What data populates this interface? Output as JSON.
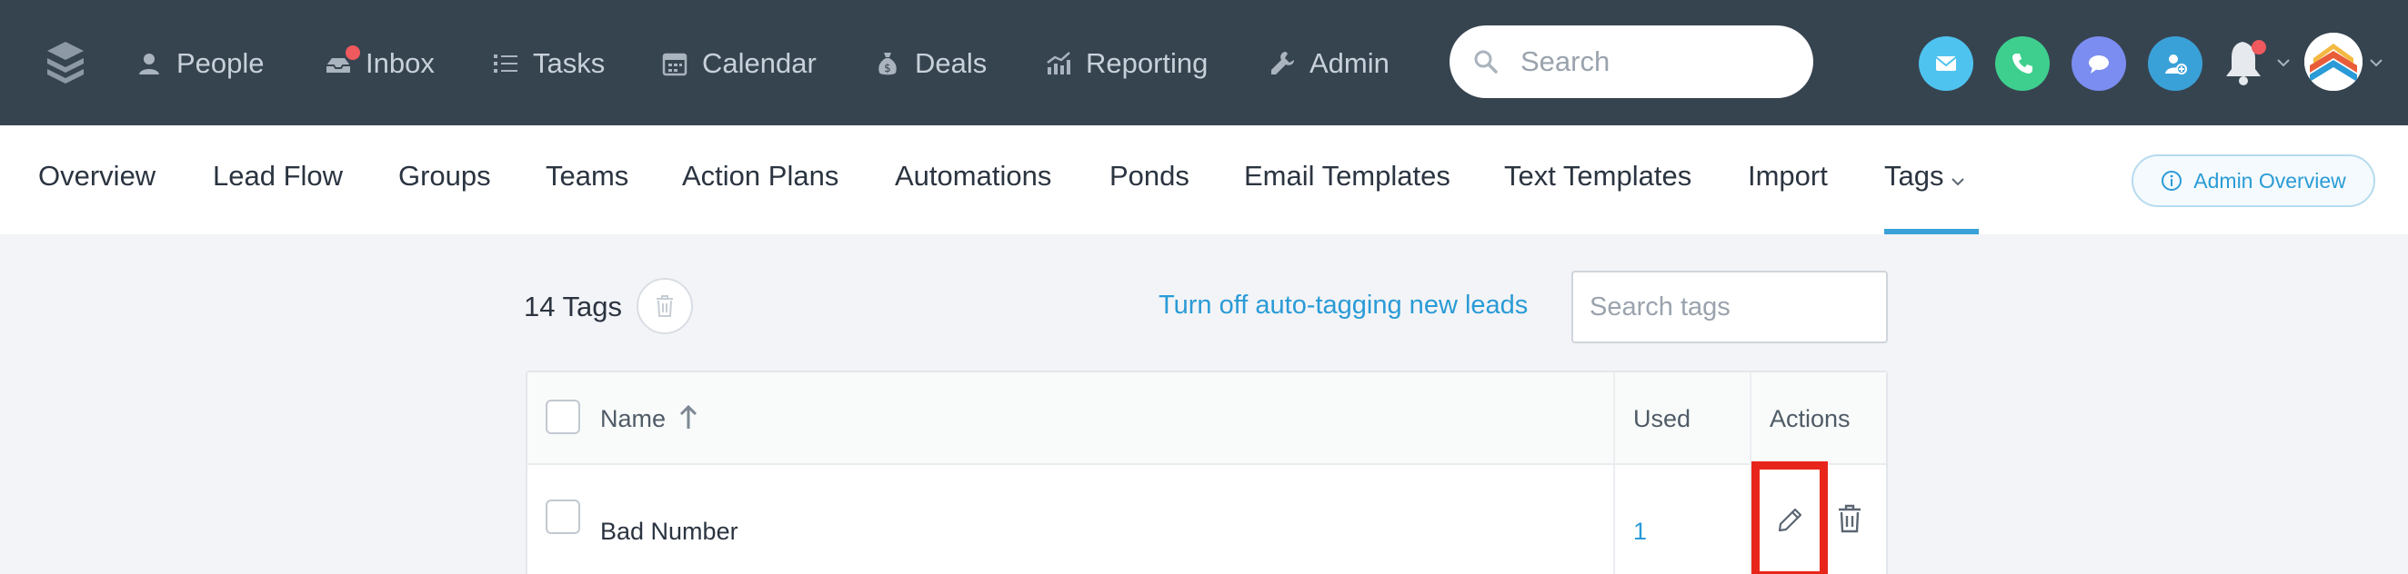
{
  "nav": {
    "items": [
      {
        "label": "People",
        "icon": "person-icon"
      },
      {
        "label": "Inbox",
        "icon": "inbox-icon"
      },
      {
        "label": "Tasks",
        "icon": "list-icon"
      },
      {
        "label": "Calendar",
        "icon": "calendar-icon"
      },
      {
        "label": "Deals",
        "icon": "money-bag-icon"
      },
      {
        "label": "Reporting",
        "icon": "chart-icon"
      },
      {
        "label": "Admin",
        "icon": "wrench-icon"
      }
    ],
    "search_placeholder": "Search",
    "quick_actions": [
      {
        "name": "email-icon",
        "color": "#4fc3f0"
      },
      {
        "name": "phone-icon",
        "color": "#3ecf8e"
      },
      {
        "name": "chat-icon",
        "color": "#7b8df0"
      },
      {
        "name": "add-person-icon",
        "color": "#3aa1d8"
      }
    ],
    "notification_color": "#f0595d"
  },
  "subnav": {
    "items": [
      "Overview",
      "Lead Flow",
      "Groups",
      "Teams",
      "Action Plans",
      "Automations",
      "Ponds",
      "Email Templates",
      "Text Templates",
      "Import",
      "Tags"
    ],
    "active": "Tags",
    "admin_overview_label": "Admin Overview"
  },
  "toolbar": {
    "tags_count": "14 Tags",
    "autotag_link": "Turn off auto-tagging new leads",
    "search_placeholder": "Search tags"
  },
  "table": {
    "columns": {
      "name": "Name",
      "used": "Used",
      "actions": "Actions"
    },
    "rows": [
      {
        "name": "Bad Number",
        "used": "1"
      }
    ]
  },
  "colors": {
    "topbar": "#364450",
    "accent": "#2a9bd6",
    "highlight": "#e8251b"
  }
}
